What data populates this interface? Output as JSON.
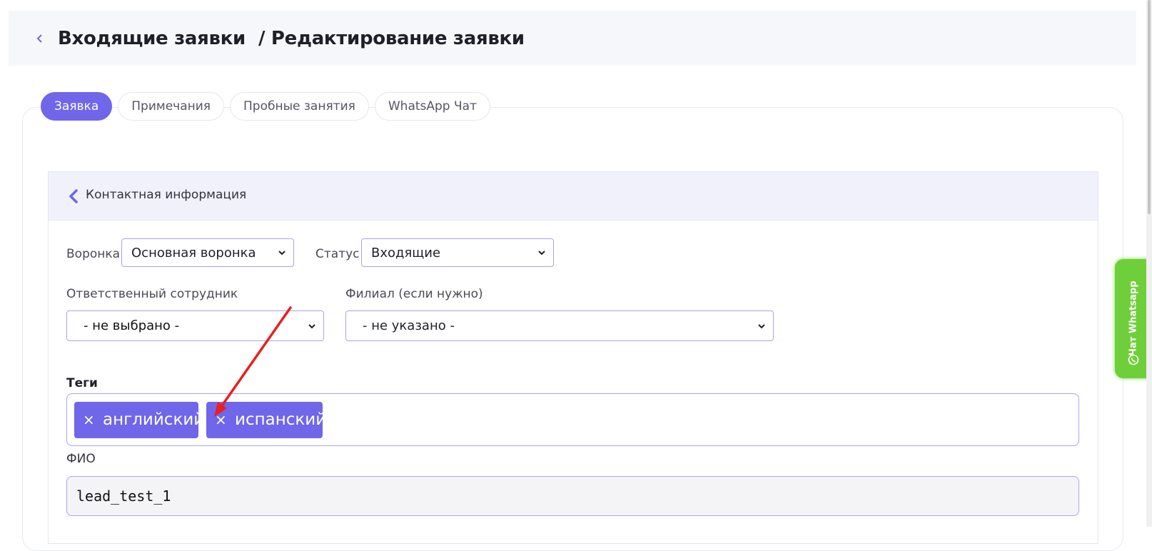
{
  "header": {
    "back_icon": "chevron-left-icon",
    "title": "Входящие заявки",
    "subtitle": "/ Редактирование заявки"
  },
  "tabs": [
    {
      "label": "Заявка",
      "active": true
    },
    {
      "label": "Примечания",
      "active": false
    },
    {
      "label": "Пробные занятия",
      "active": false
    },
    {
      "label": "WhatsApp Чат",
      "active": false
    }
  ],
  "section": {
    "title": "Контактная информация",
    "collapse_icon": "chevron-left-icon"
  },
  "form": {
    "funnel_label": "Воронка",
    "funnel_value": "Основная воронка",
    "status_label": "Статус",
    "status_value": "Входящие",
    "employee_label": "Ответственный сотрудник",
    "employee_value": "- не выбрано -",
    "branch_label": "Филиал (если нужно)",
    "branch_value": "- не указано -",
    "tags_label": "Теги",
    "tags": [
      {
        "remove": "×",
        "label": "английский"
      },
      {
        "remove": "×",
        "label": "испанский"
      }
    ],
    "fio_label": "ФИО",
    "fio_value": "lead_test_1"
  },
  "whatsapp_widget": {
    "label": "Чат Whatsapp",
    "icon": "whatsapp-icon"
  },
  "colors": {
    "accent": "#6f66ea",
    "whatsapp_green": "#6fcf3a",
    "annotation_arrow": "#e8201e"
  }
}
